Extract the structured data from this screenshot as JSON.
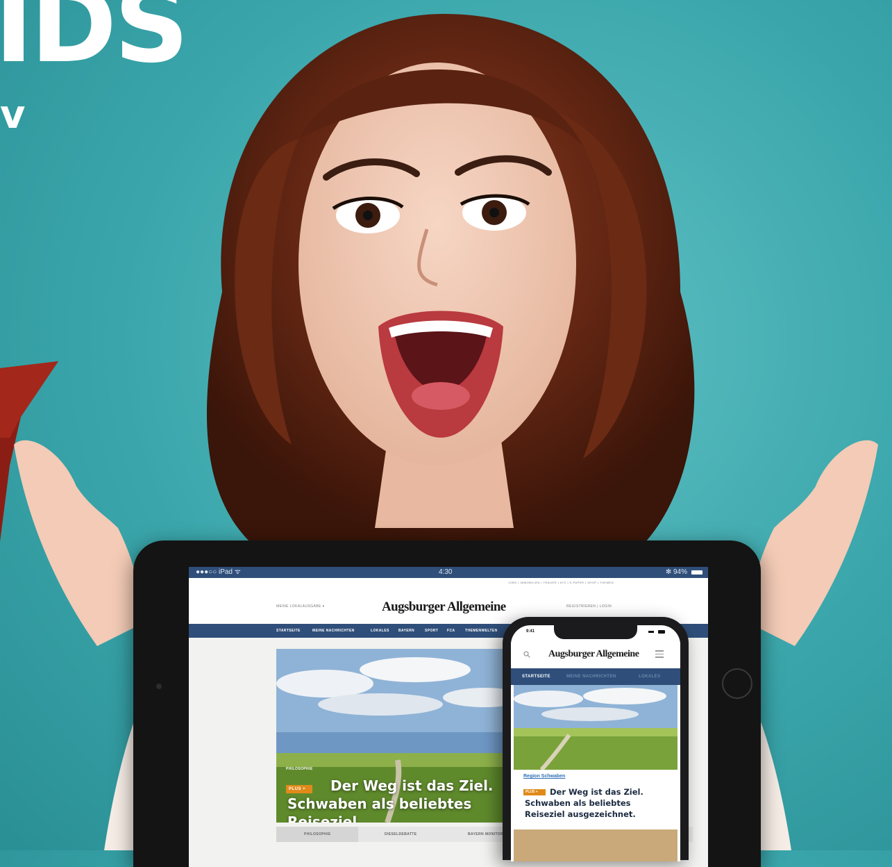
{
  "headline": {
    "fragment_large": "IDS",
    "fragment_small": "v"
  },
  "colors": {
    "background": "#3aa6ab",
    "brand_blue": "#2f4f7a",
    "plus_orange": "#e08a1a",
    "ribbon_red": "#8b1e14"
  },
  "tablet": {
    "status": {
      "left": "●●●○○ iPad ᯤ",
      "time": "4:30",
      "right": "✻ 94%"
    },
    "top_links": "JOBS | IMMOBILIEN | TRAUER | KFZ | E-PAPER | SHOP | THEMEN",
    "local_select": "MEINE LOKALAUSGABE ▾",
    "logo": "Augsburger Allgemeine",
    "account": "REGISTRIEREN | LOGIN",
    "nav": [
      "STARTSEITE",
      "MEINE NACHRICHTEN",
      "LOKALES",
      "BAYERN",
      "SPORT",
      "FCA",
      "THEMENWELTEN"
    ],
    "hero": {
      "kicker": "PHILOSOPHIE",
      "badge": "PLUS +",
      "title_line1": "Der Weg ist das Ziel.",
      "title_line2": "Schwaben als beliebtes Reiseziel"
    },
    "bottom_tabs": [
      "PHILOSOPHIE",
      "DIESELDEBATTE",
      "BAYERN MONITOR"
    ]
  },
  "phone": {
    "time": "9:41",
    "logo": "Augsburger Allgemeine",
    "nav": [
      "STARTSEITE",
      "MEINE NACHRICHTEN",
      "LOKALES"
    ],
    "region": "Region Schwaben",
    "badge": "PLUS +",
    "title_line1": "Der Weg ist das Ziel.",
    "title_line2": "Schwaben als beliebtes",
    "title_line3": "Reiseziel ausgezeichnet."
  }
}
